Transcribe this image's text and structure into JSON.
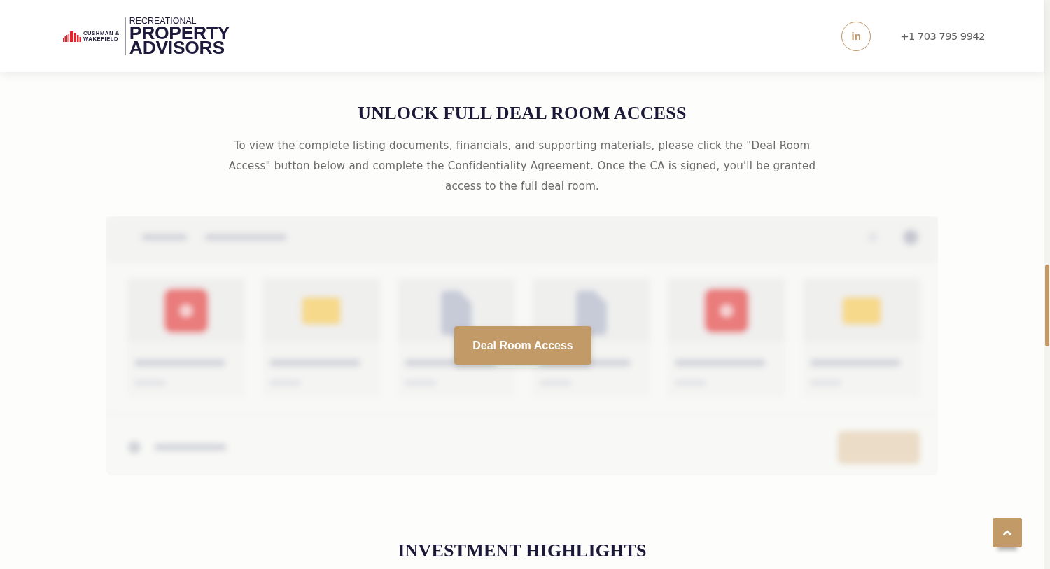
{
  "header": {
    "logo": {
      "brand_lines": [
        "CUSHMAN &",
        "WAKEFIELD"
      ],
      "subtitle": "RECREATIONAL",
      "title_lines": [
        "PROPERTY",
        "ADVISORS"
      ]
    },
    "social_link": {
      "label": "in"
    },
    "phone": "+1 703 795 9942"
  },
  "deal_room": {
    "title": "UNLOCK FULL DEAL ROOM ACCESS",
    "description": "To view the complete listing documents, financials, and supporting materials, please click the \"Deal Room Access\" button below and complete the Confidentiality Agreement. Once the CA is signed, you'll be granted access to the full deal room.",
    "preview": {
      "files": [
        {
          "kind": "pdf"
        },
        {
          "kind": "folder"
        },
        {
          "kind": "doc"
        },
        {
          "kind": "doc"
        },
        {
          "kind": "pdf"
        },
        {
          "kind": "folder"
        }
      ]
    },
    "access_button": "Deal Room Access"
  },
  "next_section": {
    "title": "INVESTMENT HIGHLIGHTS"
  }
}
